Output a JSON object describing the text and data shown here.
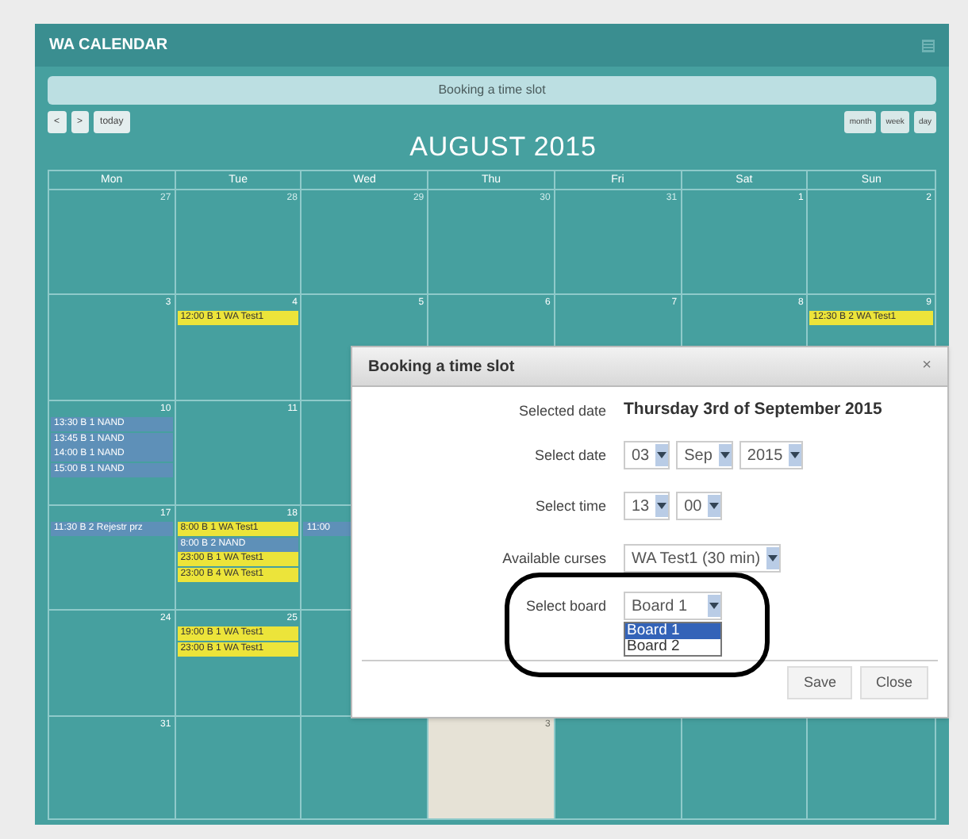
{
  "window": {
    "title": "WA CALENDAR"
  },
  "info_bar": "Booking a time slot",
  "nav_buttons": [
    {
      "label": "<"
    },
    {
      "label": ">"
    },
    {
      "label": "today"
    }
  ],
  "month_title": "AUGUST 2015",
  "view_buttons": [
    {
      "label": "month",
      "selected": false
    },
    {
      "label": "week",
      "selected": false
    },
    {
      "label": "day",
      "selected": false
    }
  ],
  "weekdays": [
    "Mon",
    "Tue",
    "Wed",
    "Thu",
    "Fri",
    "Sat",
    "Sun"
  ],
  "weeks": [
    [
      {
        "day": "27",
        "kind": "other"
      },
      {
        "day": "28",
        "kind": "other"
      },
      {
        "day": "29",
        "kind": "other"
      },
      {
        "day": "30",
        "kind": "other"
      },
      {
        "day": "31",
        "kind": "other"
      },
      {
        "day": "1",
        "kind": "current"
      },
      {
        "day": "2",
        "kind": "current"
      }
    ],
    [
      {
        "day": "3",
        "kind": "current"
      },
      {
        "day": "4",
        "kind": "current",
        "events": [
          {
            "time": "12:00",
            "text": "B 1 WA Test1",
            "color": "#ece43a"
          }
        ]
      },
      {
        "day": "5",
        "kind": "current"
      },
      {
        "day": "6",
        "kind": "current"
      },
      {
        "day": "7",
        "kind": "current"
      },
      {
        "day": "8",
        "kind": "current"
      },
      {
        "day": "9",
        "kind": "current",
        "events": [
          {
            "time": "12:30",
            "text": "B 2 WA Test1",
            "color": "#ece43a"
          }
        ]
      }
    ],
    [
      {
        "day": "10",
        "kind": "current",
        "events": [
          {
            "time": "13:30",
            "text": "B 1 NAND",
            "color": "#5e90b8"
          },
          {
            "time": "13:45",
            "text": "B 1 NAND",
            "color": "#5e90b8"
          },
          {
            "time": "14:00",
            "text": "B 1 NAND",
            "color": "#5e90b8"
          },
          {
            "time": "15:00",
            "text": "B 1 NAND",
            "color": "#5e90b8"
          }
        ]
      },
      {
        "day": "11",
        "kind": "current"
      },
      {
        "kind": "current"
      },
      {
        "kind": "current"
      },
      {
        "kind": "current"
      },
      {
        "kind": "current"
      },
      {
        "kind": "current"
      }
    ],
    [
      {
        "day": "17",
        "kind": "current",
        "events": [
          {
            "time": "11:30",
            "text": "B 2 Rejestr prz",
            "color": "#5e90b8"
          }
        ]
      },
      {
        "day": "18",
        "kind": "current",
        "events": [
          {
            "time": "8:00",
            "text": "B 1 WA Test1",
            "color": "#ece43a"
          },
          {
            "time": "8:00",
            "text": "B 2 NAND",
            "color": "#5e90b8"
          },
          {
            "time": "23:00",
            "text": "B 1 WA Test1",
            "color": "#ece43a"
          },
          {
            "time": "23:00",
            "text": "B 4 WA Test1",
            "color": "#ece43a"
          }
        ]
      },
      {
        "kind": "current",
        "events": [
          {
            "time": "11:00",
            "color": "#5e90b8"
          }
        ]
      },
      {
        "kind": "current"
      },
      {
        "kind": "current"
      },
      {
        "kind": "current"
      },
      {
        "kind": "current"
      }
    ],
    [
      {
        "day": "24",
        "kind": "current"
      },
      {
        "day": "25",
        "kind": "current",
        "events": [
          {
            "time": "19:00",
            "text": "B 1 WA Test1",
            "color": "#ece43a"
          },
          {
            "time": "23:00",
            "text": "B 1 WA Test1",
            "color": "#ece43a"
          }
        ]
      },
      {
        "kind": "current"
      },
      {
        "kind": "current"
      },
      {
        "kind": "current"
      },
      {
        "kind": "current"
      },
      {
        "kind": "current"
      }
    ],
    [
      {
        "day": "31",
        "kind": "current"
      },
      {
        "kind": "other"
      },
      {
        "kind": "other"
      },
      {
        "day": "3",
        "kind": "today"
      },
      {
        "kind": "other"
      },
      {
        "kind": "other"
      },
      {
        "kind": "other"
      }
    ]
  ],
  "dialog": {
    "title": "Booking a time slot",
    "close": "×",
    "rows": [
      {
        "kind": "text",
        "label": "Selected date",
        "value": "Thursday 3rd of September 2015"
      },
      {
        "kind": "selects",
        "label": "Select date",
        "values": [
          "03",
          "Sep",
          "2015"
        ]
      },
      {
        "kind": "selects",
        "label": "Select time",
        "values": [
          "13",
          "00"
        ]
      },
      {
        "kind": "selects",
        "label": "Available curses",
        "values": [
          "WA Test1 (30 min)"
        ]
      },
      {
        "kind": "open_select",
        "label": "Select board",
        "value": "Board 1",
        "options": [
          {
            "label": "Board 1",
            "selected": true
          },
          {
            "label": "Board 2",
            "selected": false
          }
        ]
      }
    ],
    "buttons": [
      "Save",
      "Close"
    ]
  }
}
